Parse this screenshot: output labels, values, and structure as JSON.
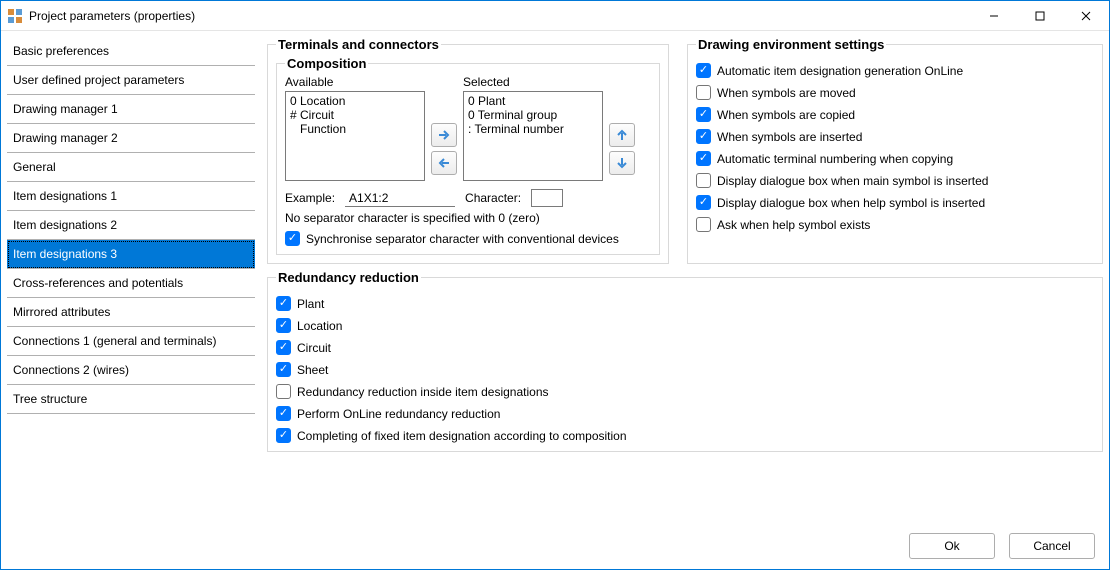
{
  "window": {
    "title": "Project parameters (properties)"
  },
  "sidebar": {
    "items": [
      {
        "label": "Basic preferences"
      },
      {
        "label": "User defined project parameters"
      },
      {
        "label": "Drawing manager 1"
      },
      {
        "label": "Drawing manager 2"
      },
      {
        "label": "General"
      },
      {
        "label": "Item designations 1"
      },
      {
        "label": "Item designations 2"
      },
      {
        "label": "Item designations 3"
      },
      {
        "label": "Cross-references and potentials"
      },
      {
        "label": "Mirrored attributes"
      },
      {
        "label": "Connections 1 (general and terminals)"
      },
      {
        "label": "Connections 2 (wires)"
      },
      {
        "label": "Tree structure"
      }
    ],
    "selected_index": 7
  },
  "terminals": {
    "group_title": "Terminals and connectors",
    "composition": {
      "title": "Composition",
      "available_label": "Available",
      "selected_label": "Selected",
      "available_text": "0 Location\n# Circuit\n   Function",
      "selected_text": "0 Plant\n0 Terminal group\n: Terminal number",
      "example_label": "Example:",
      "example_value": "A1X1:2",
      "character_label": "Character:",
      "hint": "No separator character is specified with 0 (zero)",
      "sync_label": "Synchronise separator character with conventional devices",
      "sync_checked": true
    }
  },
  "drawing_env": {
    "title": "Drawing environment settings",
    "options": [
      {
        "label": "Automatic item designation generation OnLine",
        "checked": true
      },
      {
        "label": "When symbols are moved",
        "checked": false
      },
      {
        "label": "When symbols are copied",
        "checked": true
      },
      {
        "label": "When symbols are inserted",
        "checked": true
      },
      {
        "label": "Automatic terminal numbering when copying",
        "checked": true
      },
      {
        "label": "Display dialogue box when main symbol is inserted",
        "checked": false
      },
      {
        "label": "Display dialogue box when help symbol is inserted",
        "checked": true
      },
      {
        "label": "Ask when help symbol exists",
        "checked": false
      }
    ]
  },
  "redundancy": {
    "title": "Redundancy reduction",
    "options": [
      {
        "label": "Plant",
        "checked": true
      },
      {
        "label": "Location",
        "checked": true
      },
      {
        "label": "Circuit",
        "checked": true
      },
      {
        "label": "Sheet",
        "checked": true
      },
      {
        "label": "Redundancy reduction inside item designations",
        "checked": false
      },
      {
        "label": "Perform OnLine redundancy reduction",
        "checked": true
      },
      {
        "label": "Completing of fixed item designation according to composition",
        "checked": true
      }
    ]
  },
  "buttons": {
    "ok": "Ok",
    "cancel": "Cancel"
  }
}
